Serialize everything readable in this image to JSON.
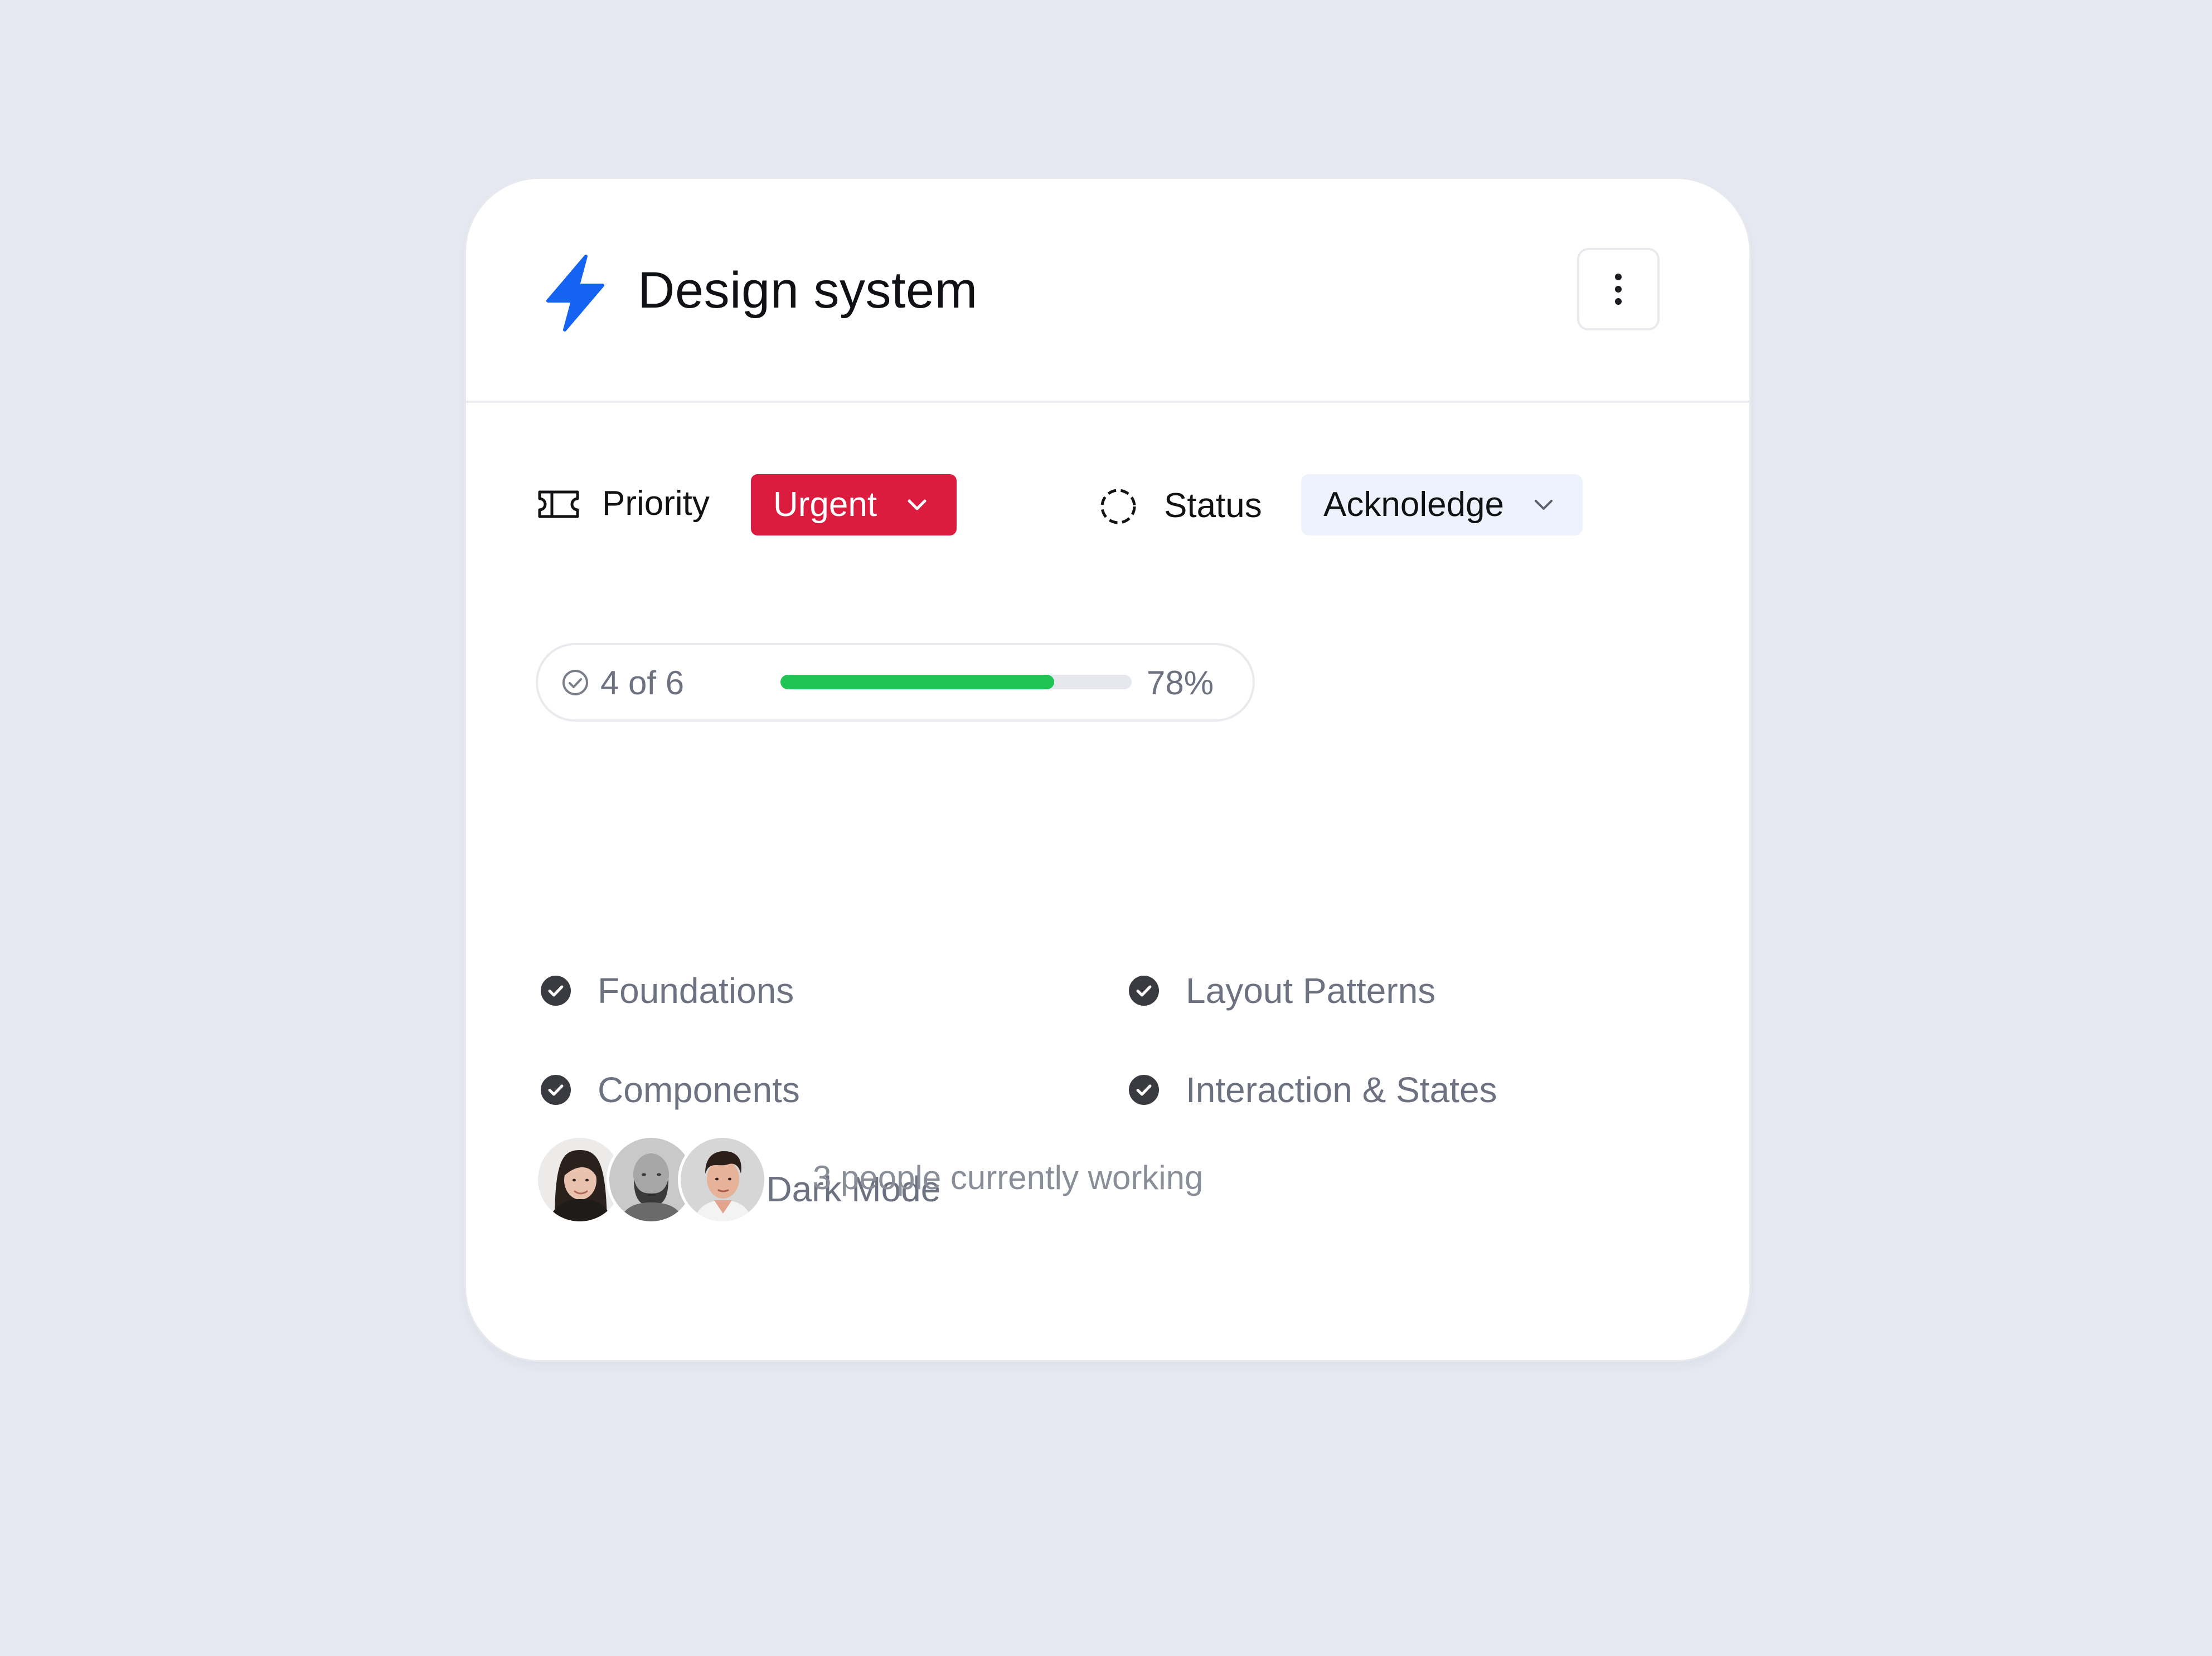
{
  "card": {
    "title": "Design system",
    "icon": "lightning-bolt-icon",
    "accent_color": "#1463F3"
  },
  "priority": {
    "label": "Priority",
    "value": "Urgent",
    "color": "#DC1C3E"
  },
  "status": {
    "label": "Status",
    "value": "Acknoledge"
  },
  "progress": {
    "count_text": "4 of 6",
    "percent_text": "78%",
    "percent": 78,
    "bar_color": "#20C454"
  },
  "tasks": [
    {
      "label": "Foundations",
      "done": true
    },
    {
      "label": "Layout Patterns",
      "done": true
    },
    {
      "label": "Components",
      "done": true
    },
    {
      "label": "Interaction & States",
      "done": true
    },
    {
      "label": "Theming / Dark Mode",
      "done": false
    }
  ],
  "team": {
    "avatars": [
      "avatar-woman",
      "avatar-bald-man",
      "avatar-young-man"
    ],
    "text": "3 people currently working"
  }
}
